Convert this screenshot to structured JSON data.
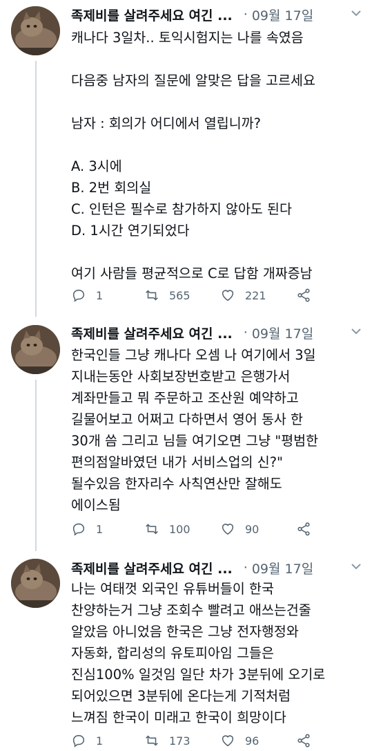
{
  "tweets": [
    {
      "author": "족제비를 살려주세요 여긴 ...",
      "separator": "·",
      "date": "09월 17일",
      "text": "캐나다 3일차.. 토익시험지는 나를 속였음\n\n다음중 남자의 질문에 알맞은 답을 고르세요\n\n남자 : 회의가 어디에서 열립니까?\n\nA. 3시에\nB. 2번 회의실\nC. 인턴은 필수로 참가하지 않아도 된다\nD. 1시간 연기되었다\n\n여기 사람들 평균적으로 C로 답함 개짜증남",
      "replies": "1",
      "retweets": "565",
      "likes": "221"
    },
    {
      "author": "족제비를 살려주세요 여긴 ...",
      "separator": "·",
      "date": "09월 17일",
      "text": "한국인들 그냥 캐나다 오셈 나 여기에서 3일\n지내는동안 사회보장번호받고 은행가서\n계좌만들고 뭐 주문하고 조산원 예약하고\n길물어보고 어쩌고 다하면서 영어 동사 한\n30개 씀 그리고 님들 여기오면 그냥 \"평범한\n편의점알바였던 내가 서비스업의 신?\"\n될수있음 한자리수 사칙연산만 잘해도\n에이스됨",
      "replies": "1",
      "retweets": "100",
      "likes": "90"
    },
    {
      "author": "족제비를 살려주세요 여긴 ...",
      "separator": "·",
      "date": "09월 17일",
      "text": "나는 여태껏 외국인 유튜버들이 한국\n찬양하는거 그냥 조회수 빨려고 애쓰는건줄\n알았음 아니었음 한국은 그냥 전자행정와\n자동화, 합리성의 유토피아임 그들은\n진심100% 일것임 일단 차가 3분뒤에 오기로\n되어있으면 3분뒤에 온다는게 기적처럼\n느껴짐 한국이 미래고 한국이 희망이다",
      "replies": "1",
      "retweets": "173",
      "likes": "96"
    }
  ],
  "icons": {
    "reply": "reply-icon",
    "retweet": "retweet-icon",
    "like": "like-icon",
    "share": "share-icon",
    "more": "chevron-down-icon",
    "avatar": "cat-avatar"
  }
}
